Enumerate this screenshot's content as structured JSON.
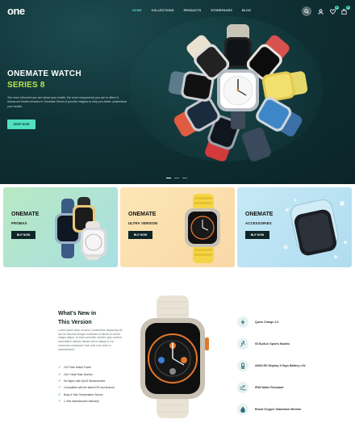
{
  "header": {
    "logo": "one",
    "nav": [
      "HOME",
      "COLLECTIONS",
      "PRODUCTS",
      "STOREPAGES",
      "BLOG"
    ],
    "active_nav": "HOME",
    "cart_count": "0",
    "wishlist_count": "0"
  },
  "hero": {
    "title": "ONEMATE WATCH",
    "subtitle": "SERIES 8",
    "description": "The more informed you are about your health, the more empowered you are to affect it. Advanced health sensors in Onemate Series 8 provide insights to help you better understand your health.",
    "button": "SHOP NOW",
    "slides": 3,
    "active_slide": 0
  },
  "categories": [
    {
      "name": "ONEMATE",
      "sub": "PROMAX",
      "button": "BUY NOW"
    },
    {
      "name": "ONEMATE",
      "sub": "ULTRA VERSION",
      "button": "BUY NOW"
    },
    {
      "name": "ONEMATE",
      "sub": "ACCESSORIES",
      "button": "BUY NOW"
    }
  ],
  "whats_new": {
    "title_line1": "What's New in",
    "title_line2": "This Version",
    "description": "Lorem ipsum dolor sit amet, consectetur adipiscing elit, sed do eiusmod tempor incididunt ut labore et dolore magna aliqua. Ut enim ad minim veniam, quis nostrud exercitation ullamco laboris nisi ut aliquip ex ea commodo consequat. Duis aute irure dolor in reprehenderit.",
    "features": [
      "24/7 New Watch Faces",
      "24x7 Heart Rate Monitor",
      "Its Higher with SpO2 Measurement",
      "Compatible with the latest iOS and Android",
      "Body & Skin Temperature Sensor",
      "1 Year Manufacturer Warranty"
    ],
    "specs": [
      "Quick Charge 2.0",
      "93 Built-In Sports Models",
      "AMOLED Display 3 Days Battery Life",
      "IP68 Water Resistant",
      "Blood Oxygen Saturation Monitor"
    ]
  },
  "colors": {
    "hero_bg": "#0f3135",
    "accent": "#4fe1c0",
    "series_green": "#b6e64b",
    "dark": "#0f2528"
  }
}
